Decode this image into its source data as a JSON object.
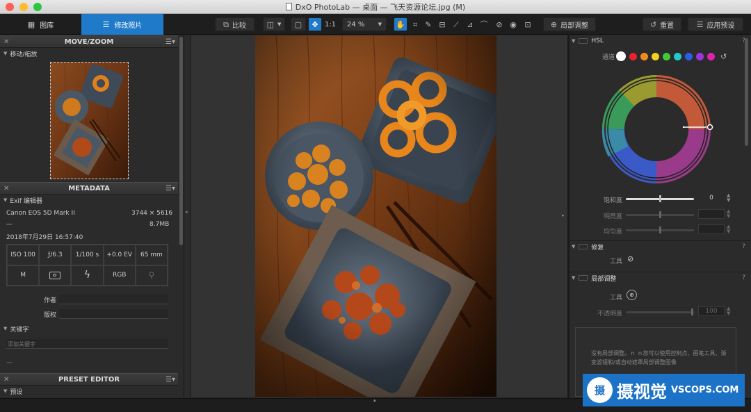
{
  "window": {
    "title": "DxO PhotoLab — 桌面 — 飞天资源论坛.jpg (M)",
    "colors": {
      "close": "#ff5f57",
      "minimize": "#febc2e",
      "zoom": "#28c840",
      "accent": "#1f7bc9"
    }
  },
  "toolbar": {
    "tab_library": "图库",
    "tab_edit": "修改照片",
    "compare_label": "比较",
    "one_to_one": "1:1",
    "zoom_value": "24 %",
    "local_adjust_label": "局部调整",
    "reset_label": "重置",
    "apply_preset_label": "应用预设"
  },
  "left_panel": {
    "move_zoom": {
      "title": "MOVE/ZOOM",
      "section": "移动/缩放"
    },
    "metadata": {
      "title": "METADATA",
      "exif_section": "Exif 编辑器",
      "camera": "Canon EOS 5D Mark II",
      "dimensions": "3744 × 5616",
      "lens": "—",
      "file_size": "8.7MB",
      "date": "2018年7月29日 16:57:40",
      "exif_grid": [
        "ISO 100",
        "ƒ/6.3",
        "1/100 s",
        "+0.0 EV",
        "65 mm"
      ],
      "exif_grid_row2": [
        "M",
        "",
        "",
        "RGB",
        ""
      ],
      "author_label": "作者",
      "copyright_label": "版权",
      "keywords_section": "关键字",
      "keywords_placeholder": "添加关键字",
      "keywords_dash": "—"
    },
    "preset_editor": {
      "title": "PRESET EDITOR",
      "section": "预设"
    }
  },
  "right_panel": {
    "hsl": {
      "title": "HSL",
      "channel_label": "通道",
      "channel_colors": [
        "#ffffff",
        "#e8222f",
        "#f08a1c",
        "#f2d21e",
        "#42c93a",
        "#23c9cf",
        "#2a5ee8",
        "#9a36e0",
        "#e022b0"
      ],
      "saturation_label": "饱和度",
      "saturation_value": "0",
      "lightness_label": "明亮度",
      "uniformity_label": "均匀度"
    },
    "repair": {
      "title": "修复",
      "tool_label": "工具"
    },
    "local": {
      "title": "局部调整",
      "tool_label": "工具",
      "opacity_label": "不透明度",
      "opacity_value": "100",
      "note": "没有局部调整。ｎ ｎ您可以使用控制点、画笔工具、渐变滤镜和/或自动遮罩局部调整图像"
    }
  },
  "watermark": {
    "logo_char": "摄",
    "name": "摄视觉",
    "site": "VSCOPS.COM"
  }
}
